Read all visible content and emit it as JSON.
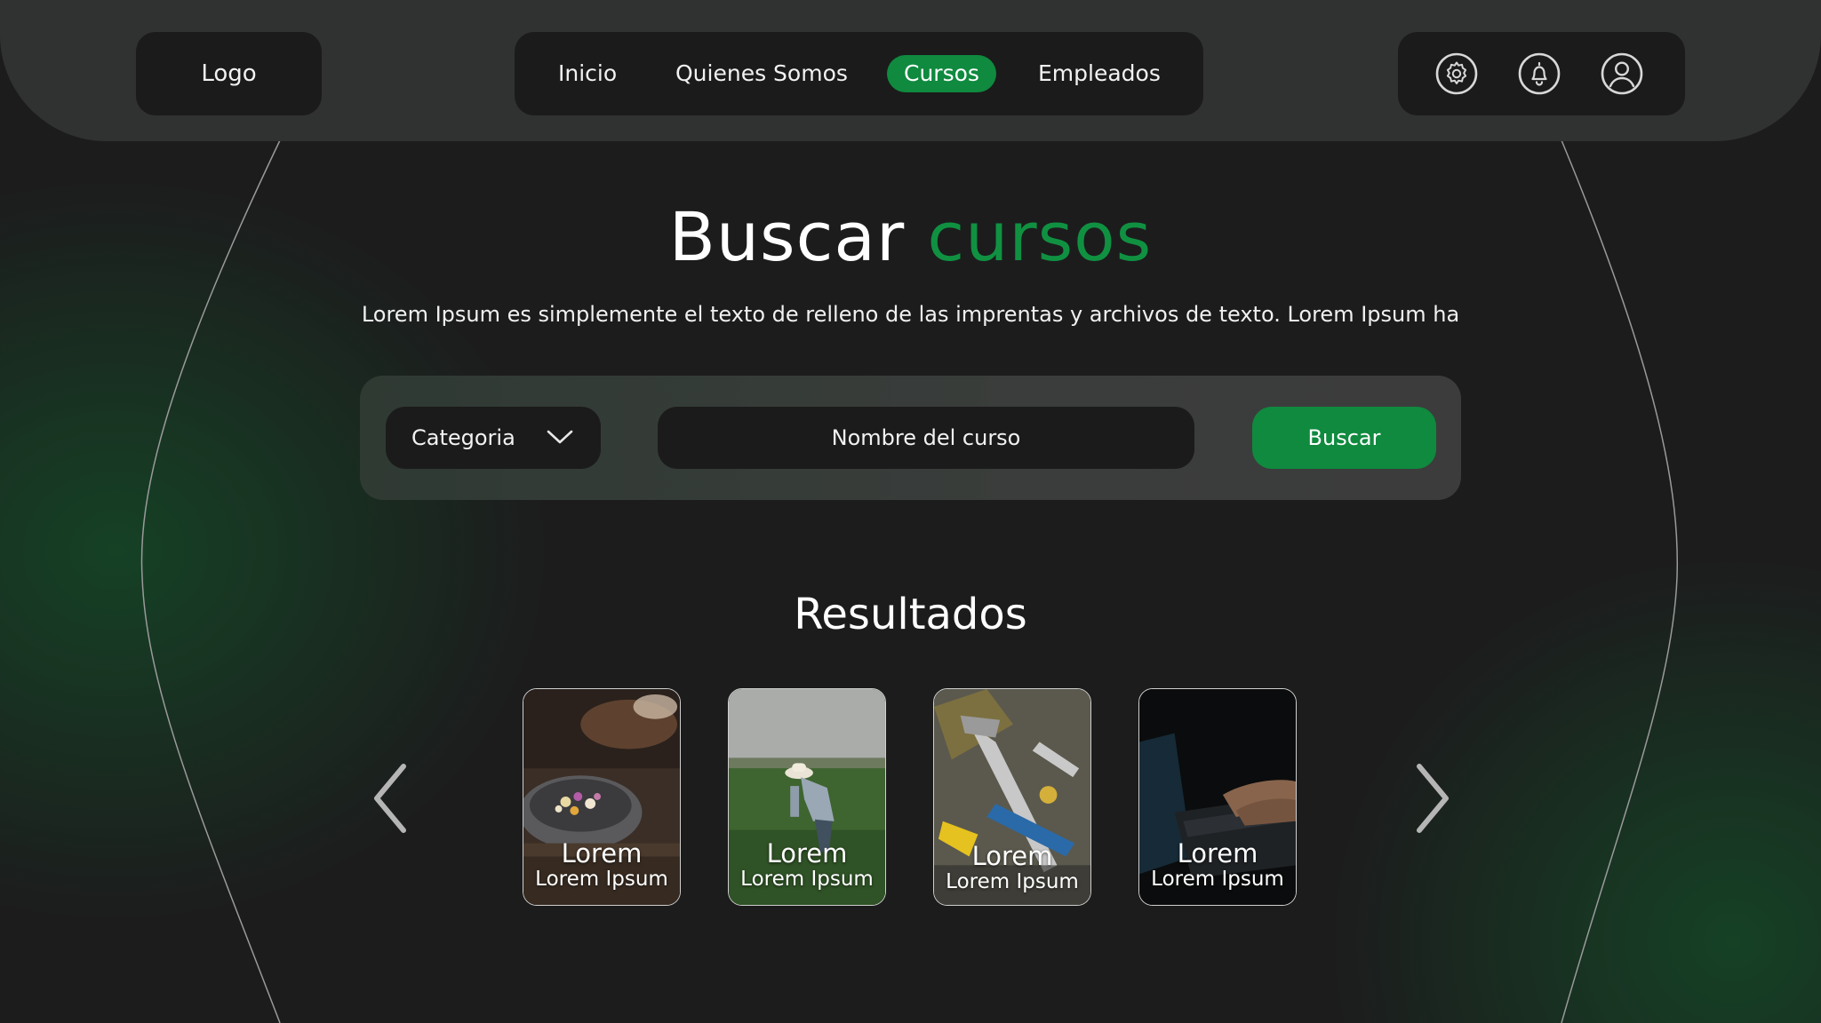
{
  "header": {
    "logo": "Logo",
    "nav": [
      {
        "label": "Inicio",
        "active": false
      },
      {
        "label": "Quienes Somos",
        "active": false
      },
      {
        "label": "Cursos",
        "active": true
      },
      {
        "label": "Empleados",
        "active": false
      }
    ],
    "icons": [
      "gear-icon",
      "bell-icon",
      "user-icon"
    ]
  },
  "hero": {
    "title_main": "Buscar",
    "title_accent": "cursos",
    "subtitle": "Lorem Ipsum es simplemente el texto de relleno de las imprentas y archivos de texto. Lorem Ipsum ha"
  },
  "search": {
    "category_label": "Categoria",
    "name_placeholder": "Nombre del curso",
    "button_label": "Buscar"
  },
  "results": {
    "title": "Resultados",
    "cards": [
      {
        "title": "Lorem",
        "subtitle": "Lorem Ipsum",
        "image": "cooking-bowl-photo"
      },
      {
        "title": "Lorem",
        "subtitle": "Lorem Ipsum",
        "image": "farmer-field-photo"
      },
      {
        "title": "Lorem",
        "subtitle": "Lorem Ipsum",
        "image": "tools-photo"
      },
      {
        "title": "Lorem",
        "subtitle": "Lorem Ipsum",
        "image": "laptop-typing-photo"
      }
    ]
  },
  "colors": {
    "accent": "#0f8a3e",
    "background": "#1c1c1d",
    "panel": "#303231",
    "pill": "#1b1b1b"
  }
}
